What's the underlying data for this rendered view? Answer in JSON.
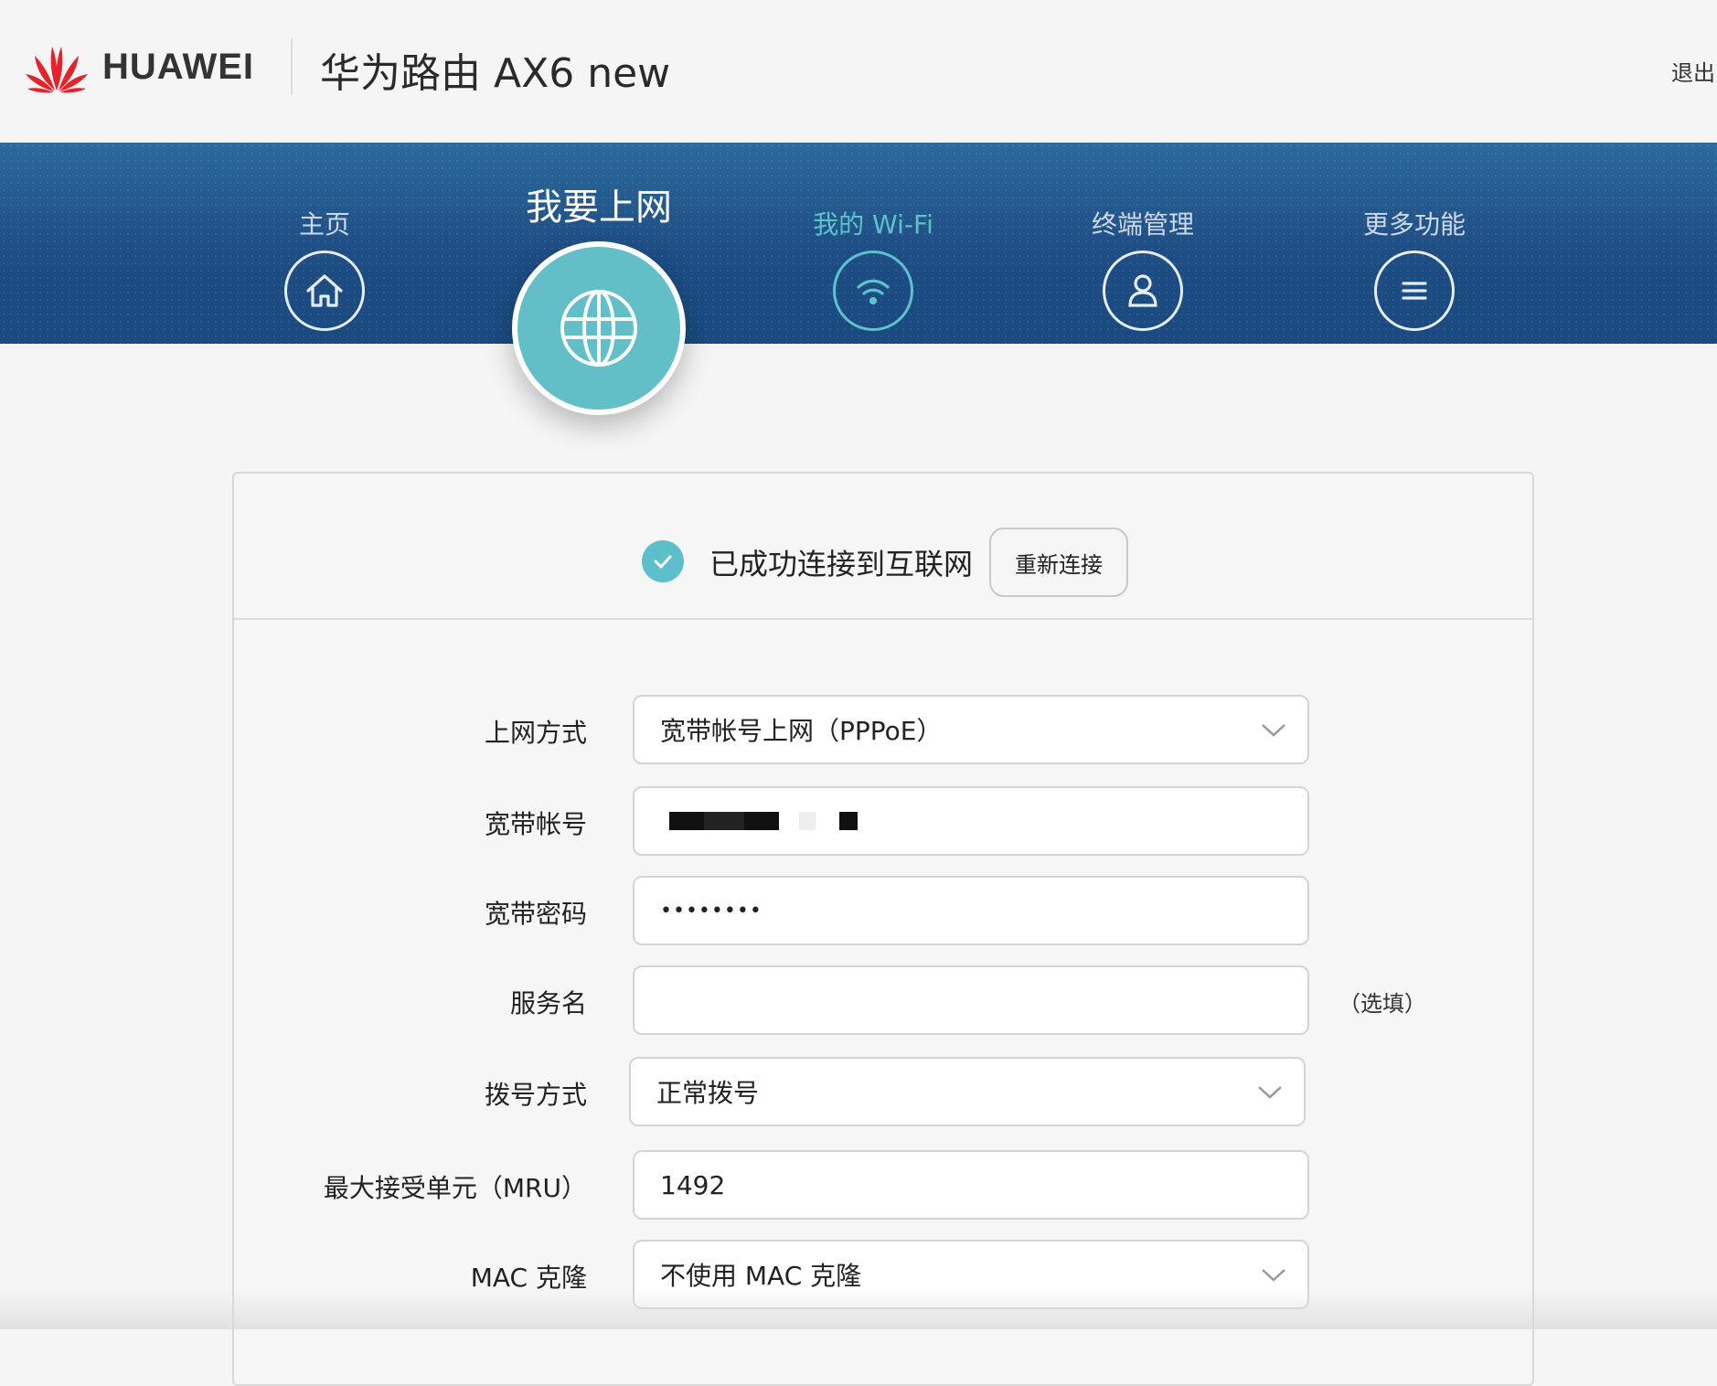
{
  "header": {
    "brand": "HUAWEI",
    "product_title": "华为路由 AX6 new",
    "logout_label": "退出"
  },
  "nav": {
    "items": [
      {
        "label": "主页",
        "icon": "home-icon"
      },
      {
        "label": "我要上网",
        "icon": "globe-icon",
        "active": true
      },
      {
        "label": "我的 Wi-Fi",
        "icon": "wifi-icon"
      },
      {
        "label": "终端管理",
        "icon": "user-icon"
      },
      {
        "label": "更多功能",
        "icon": "menu-icon"
      }
    ]
  },
  "status": {
    "text": "已成功连接到互联网",
    "reconnect_label": "重新连接"
  },
  "form": {
    "connection_type": {
      "label": "上网方式",
      "value": "宽带帐号上网（PPPoE）"
    },
    "account": {
      "label": "宽带帐号",
      "value": "(masked)"
    },
    "password": {
      "label": "宽带密码",
      "value": "••••••••"
    },
    "service_name": {
      "label": "服务名",
      "value": "",
      "hint": "（选填）"
    },
    "dial_mode": {
      "label": "拨号方式",
      "value": "正常拨号"
    },
    "mru": {
      "label": "最大接受单元（MRU）",
      "value": "1492"
    },
    "mac_clone": {
      "label": "MAC 克隆",
      "value": "不使用 MAC 克隆"
    }
  },
  "colors": {
    "brand_red": "#e3242b",
    "nav_blue": "#1e4d84",
    "accent_teal": "#62bec7"
  }
}
